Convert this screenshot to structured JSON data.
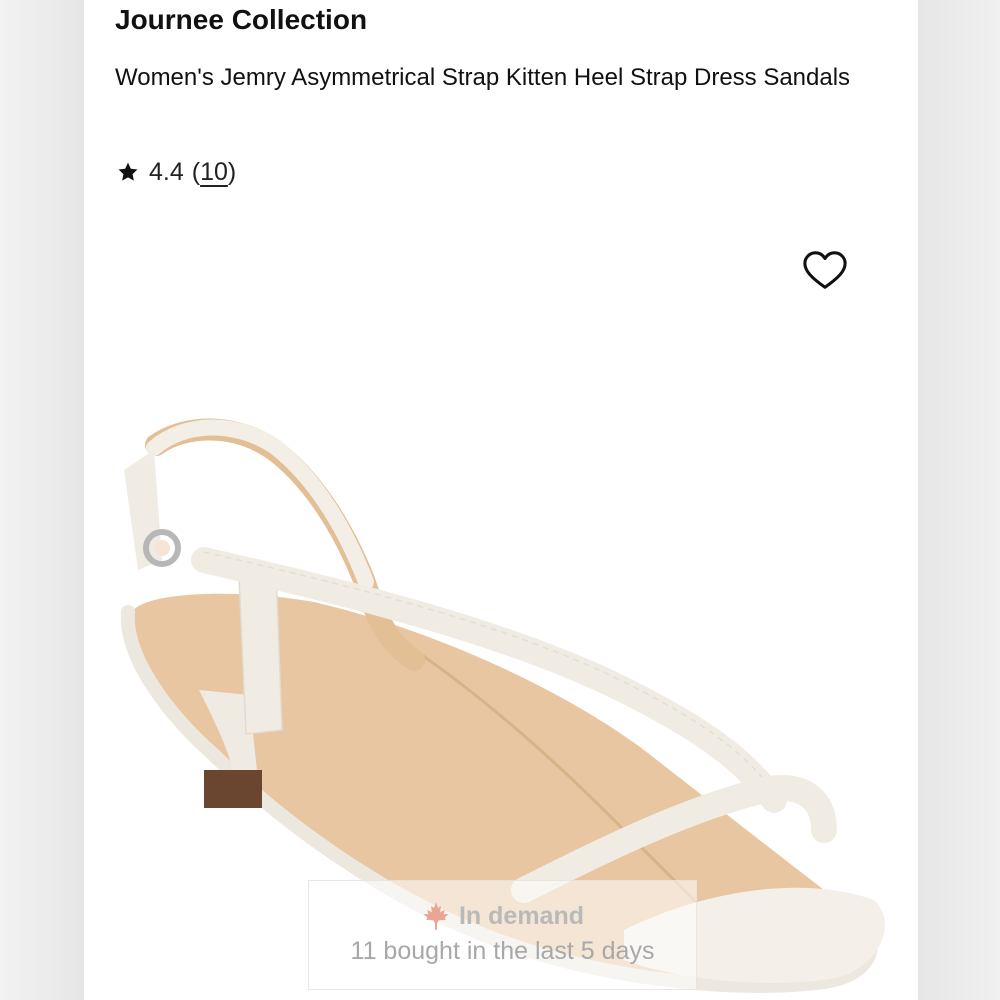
{
  "product": {
    "brand": "Journee Collection",
    "title": "Women's Jemry Asymmetrical Strap Kitten Heel Strap Dress Sandals",
    "rating": "4.4",
    "review_count": "10",
    "open_paren": "(",
    "close_paren": ")"
  },
  "badge": {
    "headline": "In demand",
    "subtext": "11 bought in the last 5 days",
    "icon": "maple-leaf-icon"
  },
  "icons": {
    "rating": "star-icon",
    "favorite": "heart-icon"
  },
  "colors": {
    "text": "#111111",
    "badge_text": "#b0b0b0",
    "badge_icon": "#e7a08e",
    "sandal_strap": "#f1ece3",
    "sandal_insole": "#e9c9a4",
    "heel_tip": "#5a3a26"
  }
}
